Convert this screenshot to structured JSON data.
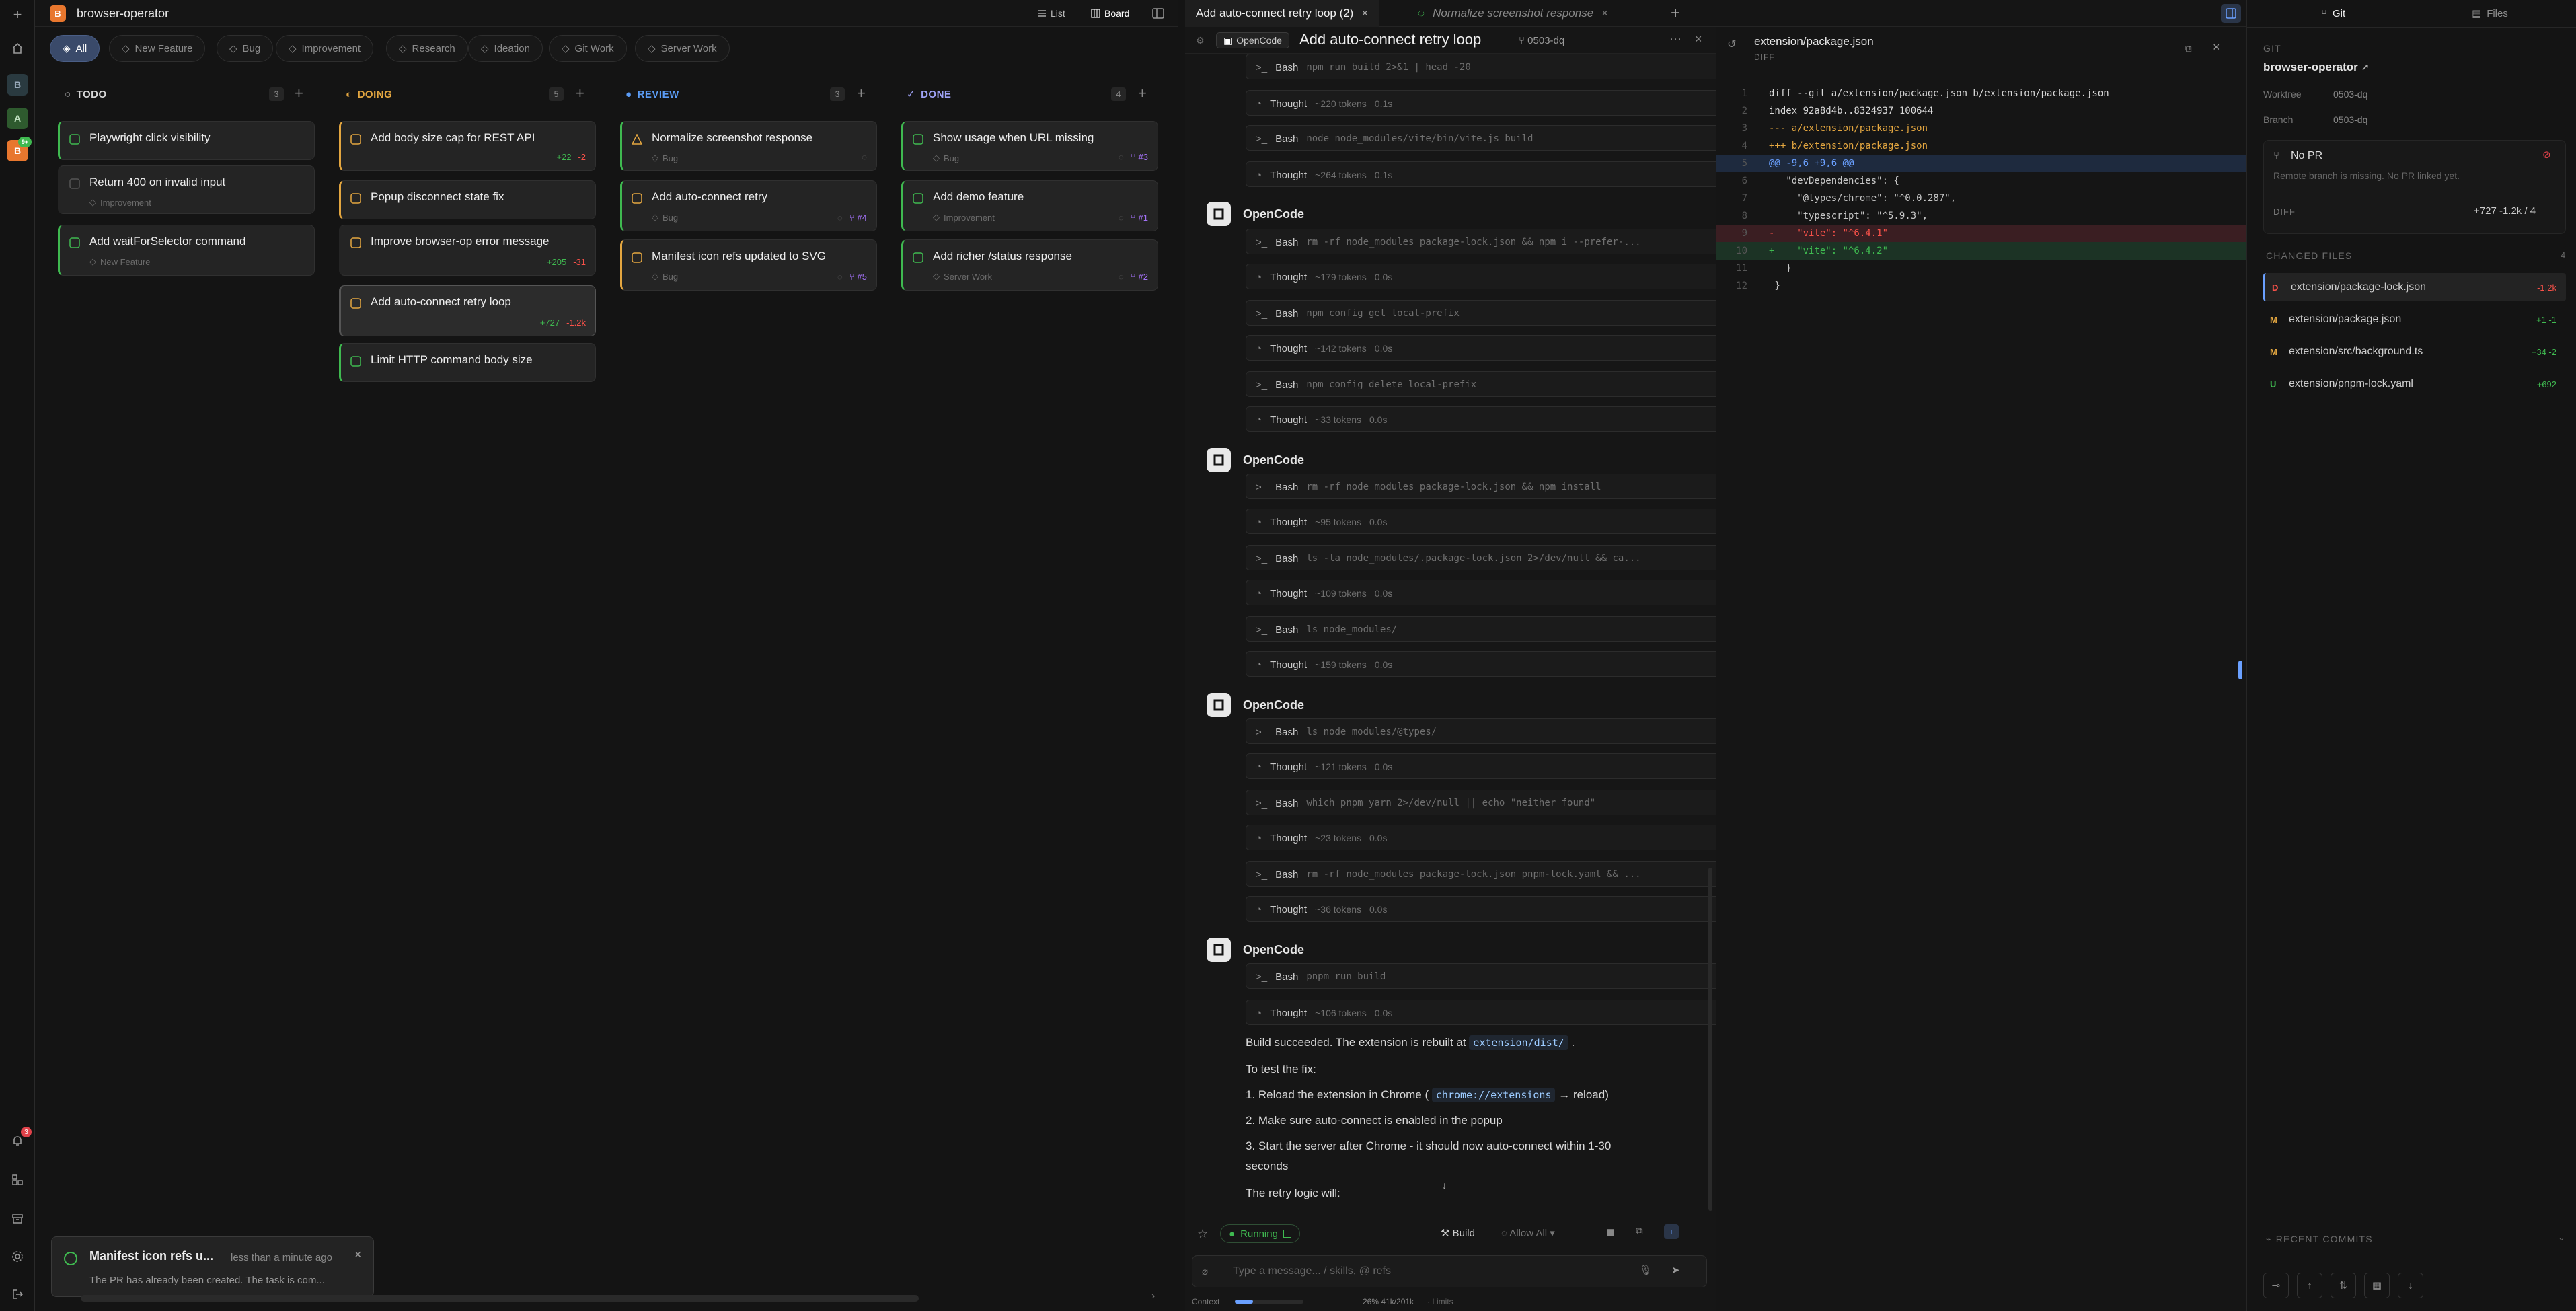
{
  "app": {
    "project_name": "browser-operator",
    "project_initial": "B"
  },
  "rail": {
    "workspaces": [
      "B",
      "A",
      "B"
    ],
    "notification_count": "3",
    "badge": "9+"
  },
  "topbar": {
    "view_list": "List",
    "view_board": "Board"
  },
  "filters": [
    "All",
    "New Feature",
    "Bug",
    "Improvement",
    "Research",
    "Ideation",
    "Git Work",
    "Server Work"
  ],
  "columns": [
    {
      "name": "TODO",
      "count": "3",
      "color": "#a0a0a0"
    },
    {
      "name": "DOING",
      "count": "5",
      "color": "#e3a640"
    },
    {
      "name": "REVIEW",
      "count": "3",
      "color": "#5b9cf5"
    },
    {
      "name": "DONE",
      "count": "4",
      "color": "#9ea2f5"
    }
  ],
  "cards": {
    "todo": [
      {
        "title": "Playwright click visibility",
        "tag": ""
      },
      {
        "title": "Return 400 on invalid input",
        "tag": "Improvement"
      },
      {
        "title": "Add waitForSelector command",
        "tag": "New Feature"
      }
    ],
    "doing": [
      {
        "title": "Add body size cap for REST API",
        "plus": "+22",
        "minus": "-2"
      },
      {
        "title": "Popup disconnect state fix"
      },
      {
        "title": "Improve browser-op error message",
        "plus": "+205",
        "minus": "-31"
      },
      {
        "title": "Add auto-connect retry loop",
        "plus": "+727",
        "minus": "-1.2k"
      },
      {
        "title": "Limit HTTP command body size"
      }
    ],
    "review": [
      {
        "title": "Normalize screenshot response",
        "tag": "Bug"
      },
      {
        "title": "Add auto-connect retry",
        "tag": "Bug",
        "pr": "#4"
      },
      {
        "title": "Manifest icon refs updated to SVG",
        "tag": "Bug",
        "pr": "#5"
      }
    ],
    "done": [
      {
        "title": "Show usage when URL missing",
        "tag": "Bug",
        "pr": "#3"
      },
      {
        "title": "Add demo feature",
        "tag": "Improvement",
        "pr": "#1"
      },
      {
        "title": "Add richer /status response",
        "tag": "Server Work",
        "pr": "#2"
      }
    ]
  },
  "toast": {
    "title": "Manifest icon refs u...",
    "time": "less than a minute ago",
    "body": "The PR has already been created. The task is com..."
  },
  "tabs": {
    "active": "Add auto-connect retry loop (2)",
    "inactive": "Normalize screenshot response"
  },
  "chat": {
    "agent_chip": "OpenCode",
    "title": "Add auto-connect retry loop",
    "branch": "0503-dq",
    "agent_name": "OpenCode",
    "tools": [
      {
        "name": "Bash",
        "arg": "npm run build 2>&1 | head -20"
      },
      {
        "name": "Thought",
        "tok": "~220 tokens",
        "time": "0.1s"
      },
      {
        "name": "Bash",
        "arg": "node node_modules/vite/bin/vite.js build"
      },
      {
        "name": "Thought",
        "tok": "~264 tokens",
        "time": "0.1s"
      },
      {
        "name": "Bash",
        "arg": "rm -rf node_modules package-lock.json && npm i --prefer-..."
      },
      {
        "name": "Thought",
        "tok": "~179 tokens",
        "time": "0.0s"
      },
      {
        "name": "Bash",
        "arg": "npm config get local-prefix"
      },
      {
        "name": "Thought",
        "tok": "~142 tokens",
        "time": "0.0s"
      },
      {
        "name": "Bash",
        "arg": "npm config delete local-prefix"
      },
      {
        "name": "Thought",
        "tok": "~33 tokens",
        "time": "0.0s"
      },
      {
        "name": "Bash",
        "arg": "rm -rf node_modules package-lock.json && npm install"
      },
      {
        "name": "Thought",
        "tok": "~95 tokens",
        "time": "0.0s"
      },
      {
        "name": "Bash",
        "arg": "ls -la node_modules/.package-lock.json 2>/dev/null && ca..."
      },
      {
        "name": "Thought",
        "tok": "~109 tokens",
        "time": "0.0s"
      },
      {
        "name": "Bash",
        "arg": "ls node_modules/"
      },
      {
        "name": "Thought",
        "tok": "~159 tokens",
        "time": "0.0s"
      },
      {
        "name": "Bash",
        "arg": "ls node_modules/@types/"
      },
      {
        "name": "Thought",
        "tok": "~121 tokens",
        "time": "0.0s"
      },
      {
        "name": "Bash",
        "arg": "which pnpm yarn 2>/dev/null || echo \"neither found\""
      },
      {
        "name": "Thought",
        "tok": "~23 tokens",
        "time": "0.0s"
      },
      {
        "name": "Bash",
        "arg": "rm -rf node_modules package-lock.json pnpm-lock.yaml && ..."
      },
      {
        "name": "Thought",
        "tok": "~36 tokens",
        "time": "0.0s"
      },
      {
        "name": "Bash",
        "arg": "pnpm run build"
      },
      {
        "name": "Thought",
        "tok": "~106 tokens",
        "time": "0.0s"
      }
    ],
    "msg1_pre": "Build succeeded. The extension is rebuilt at",
    "msg1_code": "extension/dist/",
    "msg1_post": ".",
    "msg2": "To test the fix:",
    "msg3_pre": "1. Reload the extension in Chrome (",
    "msg3_code": "chrome://extensions",
    "msg3_post": "→ reload)",
    "msg4": "2. Make sure auto-connect is enabled in the popup",
    "msg5a": "3. Start the server after Chrome - it should now auto-connect within 1-30",
    "msg5b": "seconds",
    "msg6": "The retry logic will:",
    "status": "Running",
    "build": "Build",
    "allow": "Allow All",
    "input_placeholder": "Type a message... / skills, @ refs",
    "context_label": "Context",
    "context_value": "26% 41k/201k",
    "limits": "· Limits"
  },
  "diff": {
    "filename": "extension/package.json",
    "sub": "DIFF",
    "lines": [
      {
        "n": "1",
        "t": "diff --git a/extension/package.json b/extension/package.json",
        "k": "h"
      },
      {
        "n": "2",
        "t": "index 92a8d4b..8324937 100644",
        "k": "h"
      },
      {
        "n": "3",
        "t": "--- a/extension/package.json",
        "k": "f"
      },
      {
        "n": "4",
        "t": "+++ b/extension/package.json",
        "k": "f"
      },
      {
        "n": "5",
        "t": "@@ -9,6 +9,6 @@",
        "k": "hunk"
      },
      {
        "n": "6",
        "t": "   \"devDependencies\": {",
        "k": "c"
      },
      {
        "n": "7",
        "t": "     \"@types/chrome\": \"^0.0.287\",",
        "k": "c"
      },
      {
        "n": "8",
        "t": "     \"typescript\": \"^5.9.3\",",
        "k": "c"
      },
      {
        "n": "9",
        "t": "-    \"vite\": \"^6.4.1\"",
        "k": "del"
      },
      {
        "n": "10",
        "t": "+    \"vite\": \"^6.4.2\"",
        "k": "add"
      },
      {
        "n": "11",
        "t": "   }",
        "k": "c"
      },
      {
        "n": "12",
        "t": " }",
        "k": "c"
      }
    ]
  },
  "git": {
    "tab_git": "Git",
    "tab_files": "Files",
    "section": "GIT",
    "repo": "browser-operator",
    "worktree_label": "Worktree",
    "worktree_value": "0503-dq",
    "branch_label": "Branch",
    "branch_value": "0503-dq",
    "pr_title": "No PR",
    "pr_sub": "Remote branch is missing. No PR linked yet.",
    "diff_label": "DIFF",
    "diff_value": "+727 -1.2k / 4",
    "changed_label": "CHANGED FILES",
    "changed_count": "4",
    "files": [
      {
        "status": "D",
        "name": "extension/package-lock.json",
        "delta": "-1.2k",
        "color": "#f85149"
      },
      {
        "status": "M",
        "name": "extension/package.json",
        "delta": "+1 -1",
        "color": "#e3a640"
      },
      {
        "status": "M",
        "name": "extension/src/background.ts",
        "delta": "+34 -2",
        "color": "#e3a640"
      },
      {
        "status": "U",
        "name": "extension/pnpm-lock.yaml",
        "delta": "+692",
        "color": "#3fb950"
      }
    ],
    "recent_commits": "RECENT COMMITS"
  }
}
